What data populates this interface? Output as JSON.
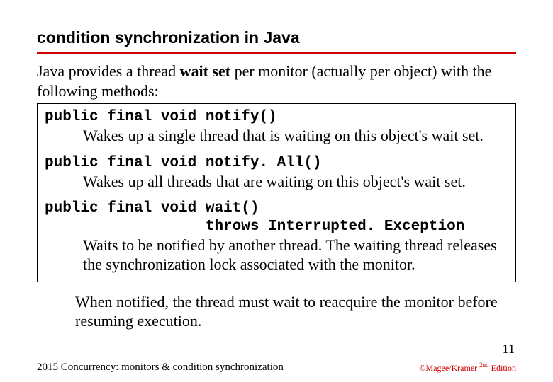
{
  "title": "condition synchronization in Java",
  "intro_pre": "Java provides a thread ",
  "intro_bold": "wait set",
  "intro_post": " per monitor (actually per object) with the following methods:",
  "methods": {
    "notify": {
      "sig": "public final void notify()",
      "desc": "Wakes up a single thread that is waiting on this object's wait set."
    },
    "notifyAll": {
      "sig": "public final void notify. All()",
      "desc": "Wakes up all threads that are waiting on this object's wait set."
    },
    "wait": {
      "sig1": "public final void wait()",
      "sig2": "                  throws Interrupted. Exception",
      "desc": "Waits to be notified by another thread. The waiting thread releases the synchronization lock associated with the monitor."
    }
  },
  "postnote": "When notified, the thread must wait to reacquire the monitor before resuming execution.",
  "pagenum": "11",
  "footer_left": "2015  Concurrency: monitors & condition synchronization",
  "footer_right_pre": "©Magee/Kramer ",
  "footer_right_sup": "2nd",
  "footer_right_post": " Edition"
}
